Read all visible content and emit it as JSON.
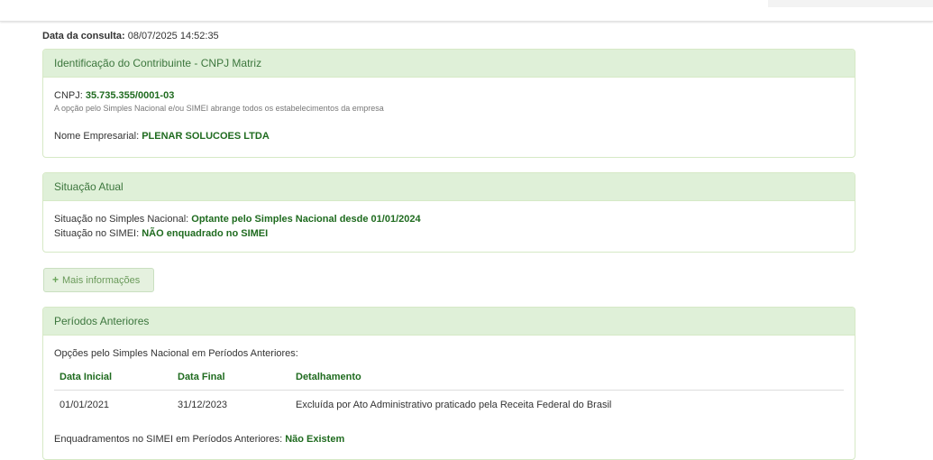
{
  "consulta": {
    "label": "Data da consulta:",
    "value": "08/07/2025 14:52:35"
  },
  "identificacao": {
    "title": "Identificação do Contribuinte - CNPJ Matriz",
    "cnpj_label": "CNPJ:",
    "cnpj_value": "35.735.355/0001-03",
    "note": "A opção pelo Simples Nacional e/ou SIMEI abrange todos os estabelecimentos da empresa",
    "nome_label": "Nome Empresarial:",
    "nome_value": "PLENAR SOLUCOES LTDA"
  },
  "situacao": {
    "title": "Situação Atual",
    "simples_label": "Situação no Simples Nacional:",
    "simples_value": "Optante pelo Simples Nacional desde 01/01/2024",
    "simei_label": "Situação no SIMEI:",
    "simei_value": "NÃO enquadrado no SIMEI"
  },
  "mais_info": {
    "label": "Mais informações"
  },
  "periodos": {
    "title": "Períodos Anteriores",
    "opcoes_label": "Opções pelo Simples Nacional em Períodos Anteriores:",
    "columns": [
      "Data Inicial",
      "Data Final",
      "Detalhamento"
    ],
    "rows": [
      {
        "inicio": "01/01/2021",
        "fim": "31/12/2023",
        "detalhe": "Excluída por Ato Administrativo praticado pela Receita Federal do Brasil"
      }
    ],
    "simei_label": "Enquadramentos no SIMEI em Períodos Anteriores:",
    "simei_value": "Não Existem"
  }
}
